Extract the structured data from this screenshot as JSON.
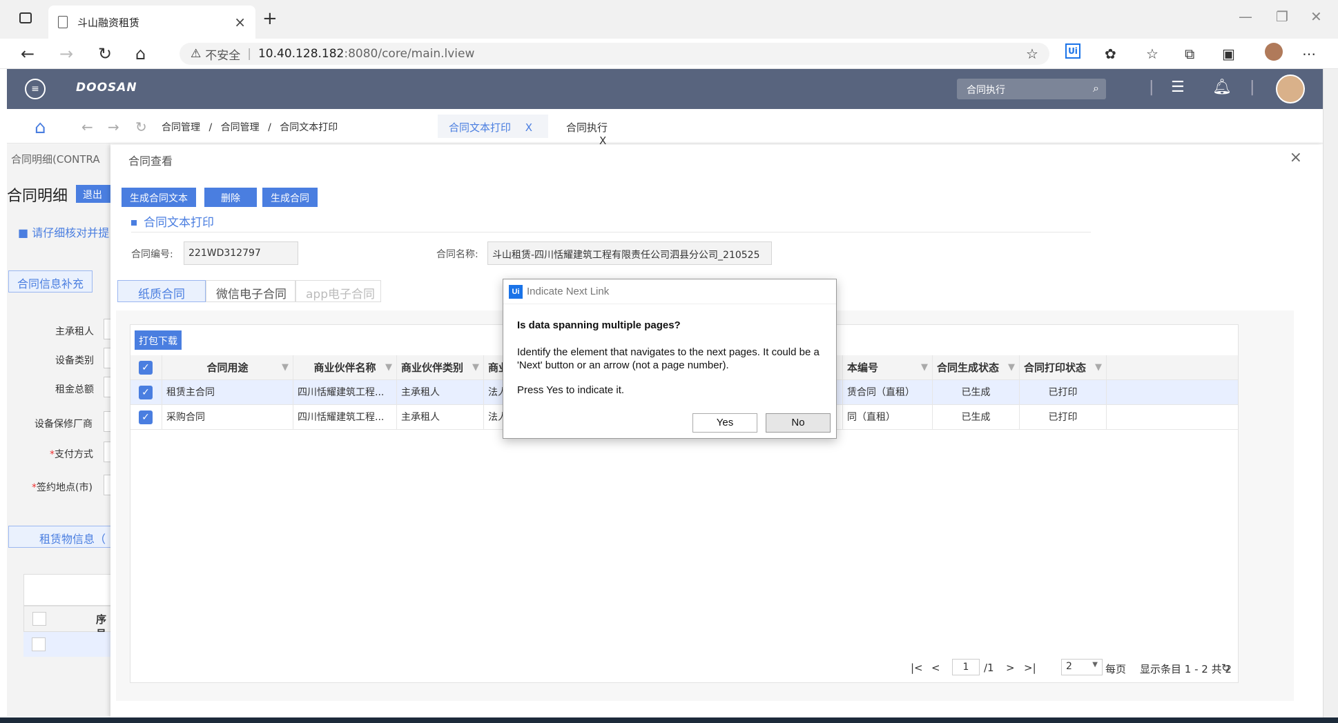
{
  "browser": {
    "tab_title": "斗山融资租赁",
    "tab_close": "×",
    "new_tab": "+",
    "url_warning": "不安全",
    "url_host": "10.40.128.182",
    "url_path": ":8080/core/main.lview",
    "ui_ext": "Ui"
  },
  "app": {
    "logo": "DOOSAN",
    "search_value": "合同执行"
  },
  "breadcrumb": {
    "items": [
      "合同管理",
      "合同管理",
      "合同文本打印"
    ],
    "sep": "/"
  },
  "page_tabs": [
    {
      "label": "合同文本打印",
      "close": "X"
    },
    {
      "label": "合同执行",
      "close": "X"
    }
  ],
  "background_page": {
    "title": "合同明细(CONTRA",
    "heading": "合同明细",
    "exit": "退出",
    "notice": "请仔细核对并提",
    "tab_supplement": "合同信息补充",
    "labels": [
      "主承租人",
      "设备类别",
      "租金总额",
      "设备保修厂商",
      "支付方式",
      "签约地点(市)"
    ],
    "required_mark": "*",
    "tab_lease": "租赁物信息（",
    "col_seq": "序号"
  },
  "panel": {
    "title": "合同查看",
    "close": "×",
    "buttons": [
      "生成合同文本",
      "删除",
      "生成合同"
    ],
    "section_title": "合同文本打印",
    "contract_no_label": "合同编号:",
    "contract_no_value": "221WD312797",
    "contract_name_label": "合同名称:",
    "contract_name_value": "斗山租赁-四川恬耀建筑工程有限责任公司泗县分公司_210525",
    "subtabs": [
      "纸质合同",
      "微信电子合同",
      "app电子合同"
    ],
    "download_btn": "打包下载"
  },
  "table": {
    "headers": [
      "合同用途",
      "商业伙伴名称",
      "商业伙伴类别",
      "商业",
      "本编号",
      "合同生成状态",
      "合同打印状态"
    ],
    "rows": [
      {
        "purpose": "租赁主合同",
        "partner": "四川恬耀建筑工程...",
        "type": "主承租人",
        "cat": "法人",
        "textno": "赁合同（直租）",
        "gen": "已生成",
        "print": "已打印"
      },
      {
        "purpose": "采购合同",
        "partner": "四川恬耀建筑工程...",
        "type": "主承租人",
        "cat": "法人",
        "textno": "同（直租）",
        "gen": "已生成",
        "print": "已打印"
      }
    ]
  },
  "pager": {
    "page": "1",
    "total_pages": "/1",
    "per_page": "2",
    "per_page_label": "每页",
    "summary": "显示条目 1 - 2 共 2"
  },
  "dialog": {
    "logo": "Ui",
    "title": "Indicate Next Link",
    "question": "Is data spanning multiple pages?",
    "message": "Identify the element that navigates to the next pages. It could be a 'Next' button or an arrow (not a page number).",
    "message2": "Press Yes to indicate it.",
    "yes": "Yes",
    "no": "No"
  }
}
